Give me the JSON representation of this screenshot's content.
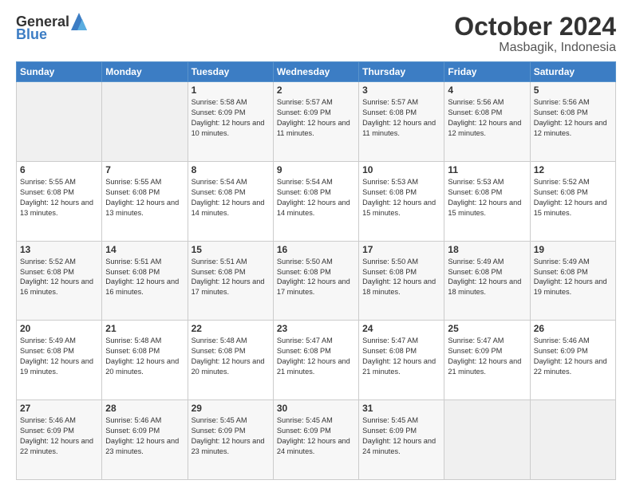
{
  "logo": {
    "general": "General",
    "blue": "Blue"
  },
  "header": {
    "month": "October 2024",
    "location": "Masbagik, Indonesia"
  },
  "weekdays": [
    "Sunday",
    "Monday",
    "Tuesday",
    "Wednesday",
    "Thursday",
    "Friday",
    "Saturday"
  ],
  "weeks": [
    [
      {
        "day": "",
        "info": ""
      },
      {
        "day": "",
        "info": ""
      },
      {
        "day": "1",
        "info": "Sunrise: 5:58 AM\nSunset: 6:09 PM\nDaylight: 12 hours and 10 minutes."
      },
      {
        "day": "2",
        "info": "Sunrise: 5:57 AM\nSunset: 6:09 PM\nDaylight: 12 hours and 11 minutes."
      },
      {
        "day": "3",
        "info": "Sunrise: 5:57 AM\nSunset: 6:08 PM\nDaylight: 12 hours and 11 minutes."
      },
      {
        "day": "4",
        "info": "Sunrise: 5:56 AM\nSunset: 6:08 PM\nDaylight: 12 hours and 12 minutes."
      },
      {
        "day": "5",
        "info": "Sunrise: 5:56 AM\nSunset: 6:08 PM\nDaylight: 12 hours and 12 minutes."
      }
    ],
    [
      {
        "day": "6",
        "info": "Sunrise: 5:55 AM\nSunset: 6:08 PM\nDaylight: 12 hours and 13 minutes."
      },
      {
        "day": "7",
        "info": "Sunrise: 5:55 AM\nSunset: 6:08 PM\nDaylight: 12 hours and 13 minutes."
      },
      {
        "day": "8",
        "info": "Sunrise: 5:54 AM\nSunset: 6:08 PM\nDaylight: 12 hours and 14 minutes."
      },
      {
        "day": "9",
        "info": "Sunrise: 5:54 AM\nSunset: 6:08 PM\nDaylight: 12 hours and 14 minutes."
      },
      {
        "day": "10",
        "info": "Sunrise: 5:53 AM\nSunset: 6:08 PM\nDaylight: 12 hours and 15 minutes."
      },
      {
        "day": "11",
        "info": "Sunrise: 5:53 AM\nSunset: 6:08 PM\nDaylight: 12 hours and 15 minutes."
      },
      {
        "day": "12",
        "info": "Sunrise: 5:52 AM\nSunset: 6:08 PM\nDaylight: 12 hours and 15 minutes."
      }
    ],
    [
      {
        "day": "13",
        "info": "Sunrise: 5:52 AM\nSunset: 6:08 PM\nDaylight: 12 hours and 16 minutes."
      },
      {
        "day": "14",
        "info": "Sunrise: 5:51 AM\nSunset: 6:08 PM\nDaylight: 12 hours and 16 minutes."
      },
      {
        "day": "15",
        "info": "Sunrise: 5:51 AM\nSunset: 6:08 PM\nDaylight: 12 hours and 17 minutes."
      },
      {
        "day": "16",
        "info": "Sunrise: 5:50 AM\nSunset: 6:08 PM\nDaylight: 12 hours and 17 minutes."
      },
      {
        "day": "17",
        "info": "Sunrise: 5:50 AM\nSunset: 6:08 PM\nDaylight: 12 hours and 18 minutes."
      },
      {
        "day": "18",
        "info": "Sunrise: 5:49 AM\nSunset: 6:08 PM\nDaylight: 12 hours and 18 minutes."
      },
      {
        "day": "19",
        "info": "Sunrise: 5:49 AM\nSunset: 6:08 PM\nDaylight: 12 hours and 19 minutes."
      }
    ],
    [
      {
        "day": "20",
        "info": "Sunrise: 5:49 AM\nSunset: 6:08 PM\nDaylight: 12 hours and 19 minutes."
      },
      {
        "day": "21",
        "info": "Sunrise: 5:48 AM\nSunset: 6:08 PM\nDaylight: 12 hours and 20 minutes."
      },
      {
        "day": "22",
        "info": "Sunrise: 5:48 AM\nSunset: 6:08 PM\nDaylight: 12 hours and 20 minutes."
      },
      {
        "day": "23",
        "info": "Sunrise: 5:47 AM\nSunset: 6:08 PM\nDaylight: 12 hours and 21 minutes."
      },
      {
        "day": "24",
        "info": "Sunrise: 5:47 AM\nSunset: 6:08 PM\nDaylight: 12 hours and 21 minutes."
      },
      {
        "day": "25",
        "info": "Sunrise: 5:47 AM\nSunset: 6:09 PM\nDaylight: 12 hours and 21 minutes."
      },
      {
        "day": "26",
        "info": "Sunrise: 5:46 AM\nSunset: 6:09 PM\nDaylight: 12 hours and 22 minutes."
      }
    ],
    [
      {
        "day": "27",
        "info": "Sunrise: 5:46 AM\nSunset: 6:09 PM\nDaylight: 12 hours and 22 minutes."
      },
      {
        "day": "28",
        "info": "Sunrise: 5:46 AM\nSunset: 6:09 PM\nDaylight: 12 hours and 23 minutes."
      },
      {
        "day": "29",
        "info": "Sunrise: 5:45 AM\nSunset: 6:09 PM\nDaylight: 12 hours and 23 minutes."
      },
      {
        "day": "30",
        "info": "Sunrise: 5:45 AM\nSunset: 6:09 PM\nDaylight: 12 hours and 24 minutes."
      },
      {
        "day": "31",
        "info": "Sunrise: 5:45 AM\nSunset: 6:09 PM\nDaylight: 12 hours and 24 minutes."
      },
      {
        "day": "",
        "info": ""
      },
      {
        "day": "",
        "info": ""
      }
    ]
  ]
}
